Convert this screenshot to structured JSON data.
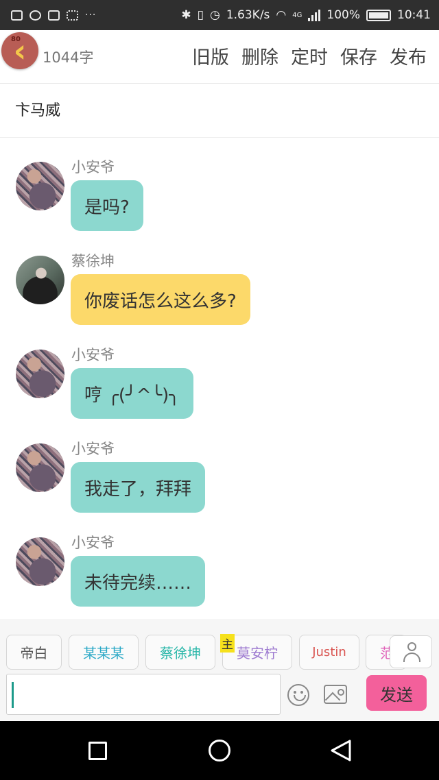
{
  "status_bar": {
    "more": "···",
    "speed": "1.63K/s",
    "network": "4G",
    "battery": "100%",
    "time": "10:41"
  },
  "header": {
    "back_badge": "80",
    "word_count": "1044字",
    "actions": [
      "旧版",
      "删除",
      "定时",
      "保存",
      "发布"
    ]
  },
  "title": "卞马威",
  "messages": [
    {
      "sender": "小安爷",
      "text": "是吗?",
      "avatar": "girl-avatar",
      "color": "teal"
    },
    {
      "sender": "蔡徐坤",
      "text": "你废话怎么这么多?",
      "avatar": "man-avatar",
      "color": "yellow"
    },
    {
      "sender": "小安爷",
      "text": "哼  ╭(╯^╰)╮",
      "avatar": "girl-avatar",
      "color": "teal"
    },
    {
      "sender": "小安爷",
      "text": "我走了，拜拜",
      "avatar": "girl-avatar",
      "color": "teal"
    },
    {
      "sender": "小安爷",
      "text": "未待完续……",
      "avatar": "girl-avatar",
      "color": "teal"
    }
  ],
  "characters": [
    {
      "name": "帝白",
      "color": "#555555"
    },
    {
      "name": "某某某",
      "color": "#2aa8c6"
    },
    {
      "name": "蔡徐坤",
      "color": "#2ab7a9"
    },
    {
      "name": "莫安柠",
      "color": "#9d7ad0",
      "tag": "主"
    },
    {
      "name": "Justin",
      "color": "#d9534f"
    },
    {
      "name": "范",
      "color": "#e060b8"
    }
  ],
  "input": {
    "value": "",
    "placeholder": ""
  },
  "send_label": "发送",
  "colors": {
    "teal_bubble": "#8cd8cf",
    "yellow_bubble": "#fcd96a",
    "send": "#f3609b"
  },
  "icons": [
    "emoji-icon",
    "image-icon",
    "user-icon",
    "back-arrow-icon"
  ]
}
